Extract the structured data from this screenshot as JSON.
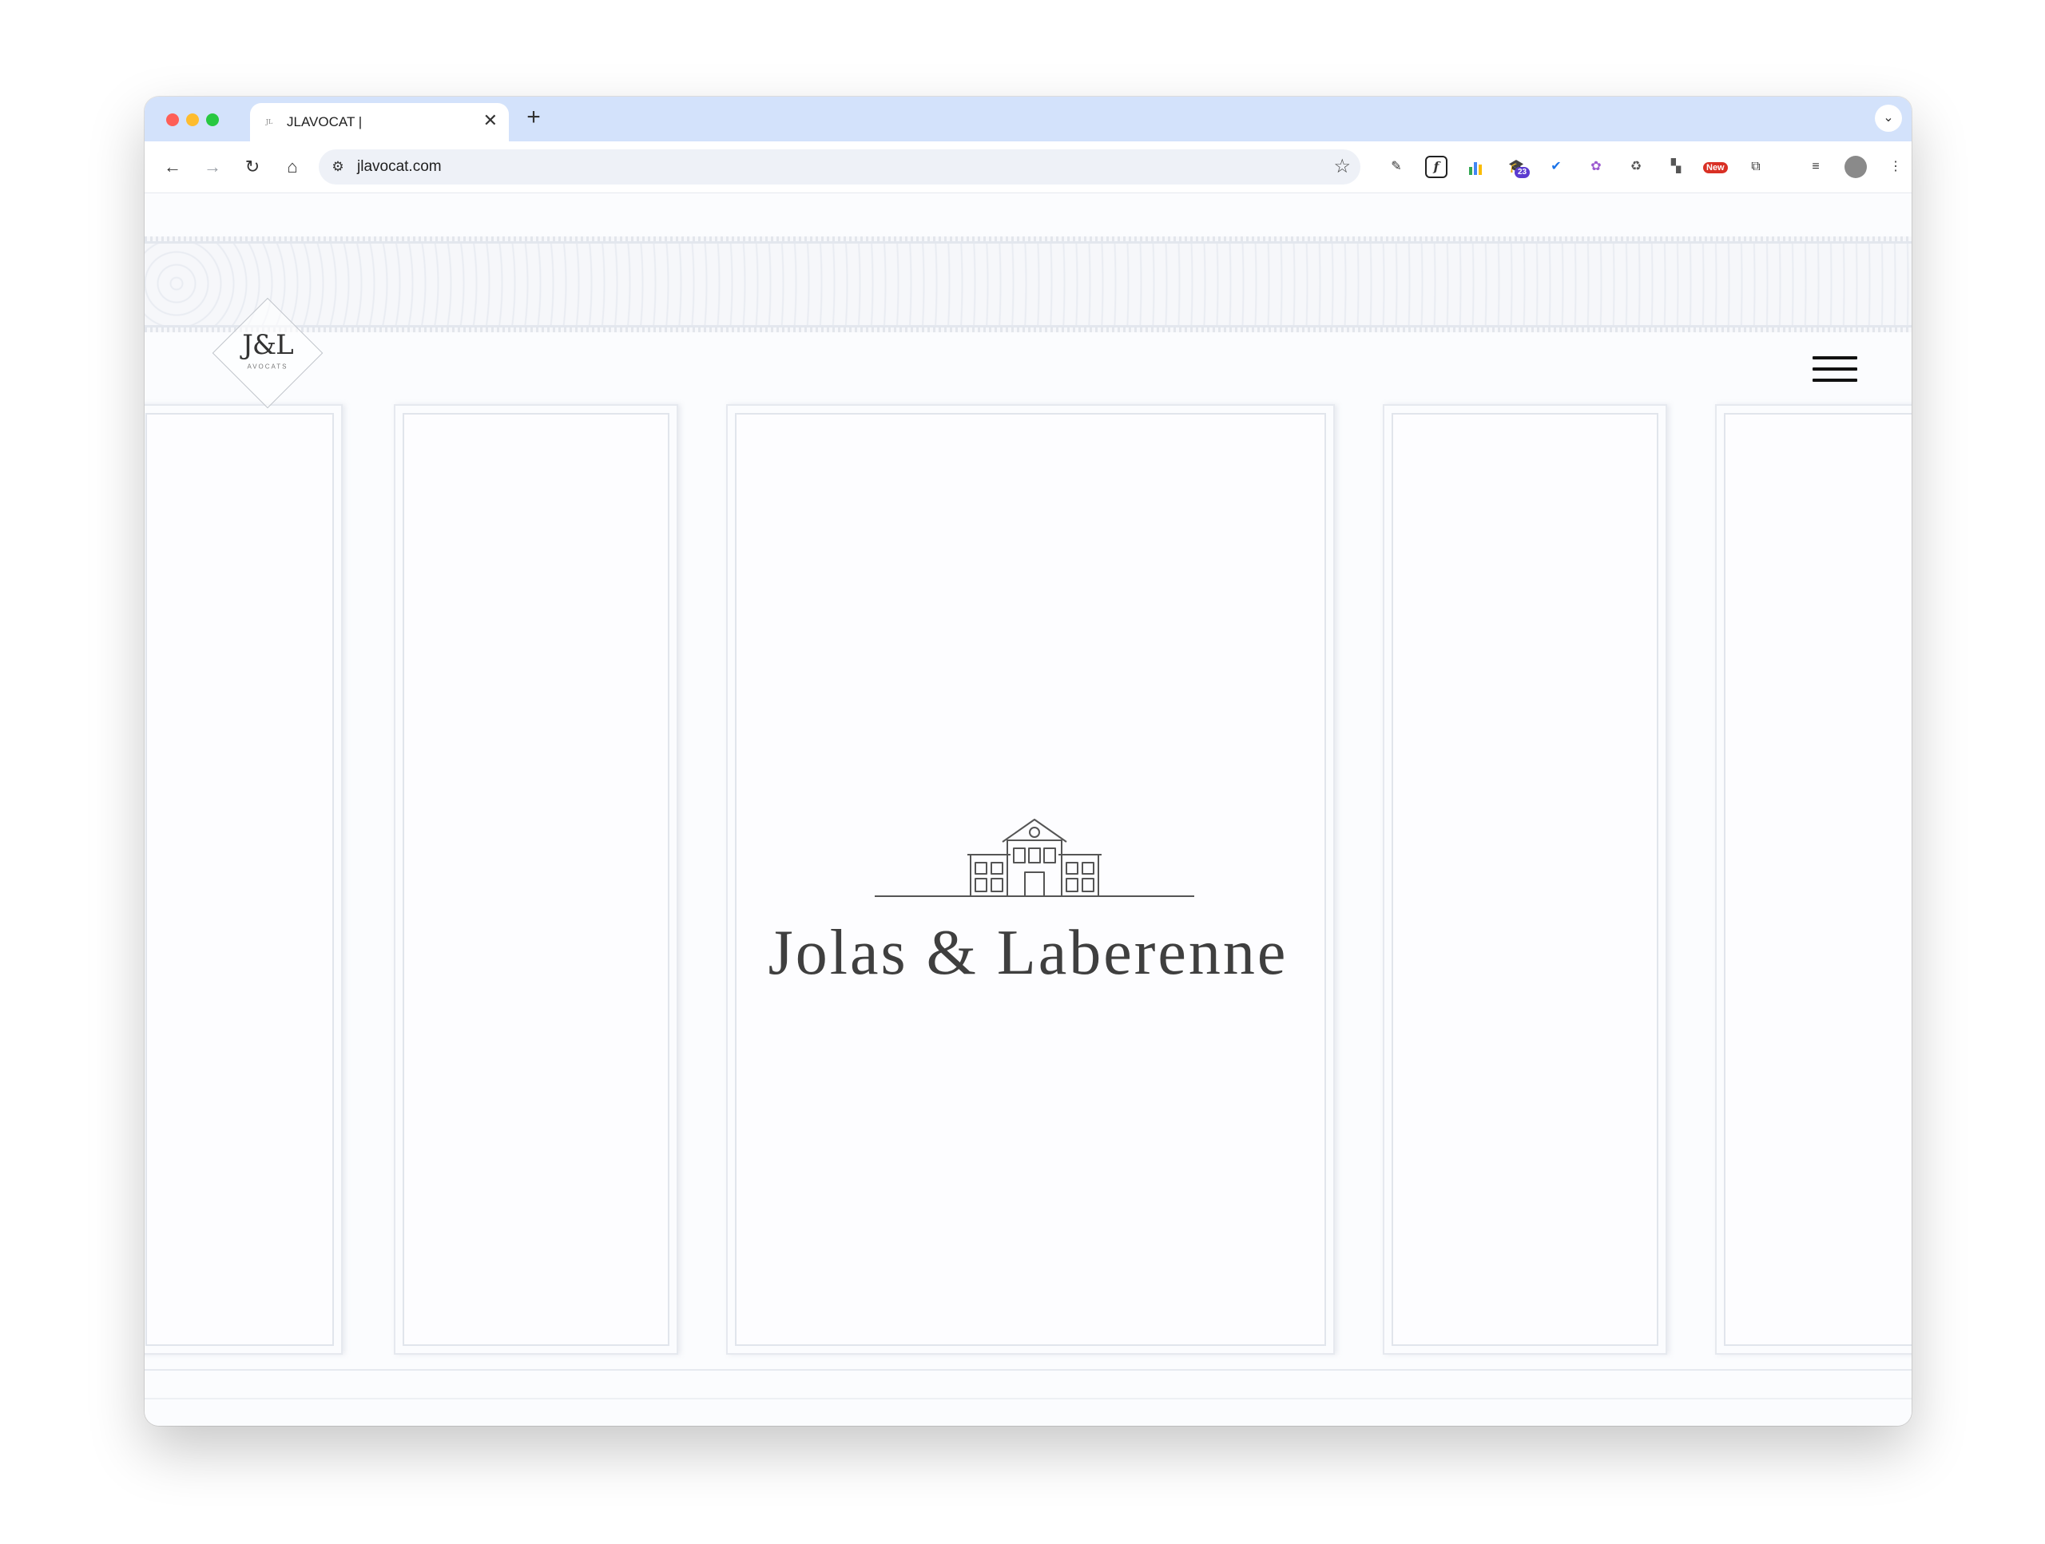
{
  "browser": {
    "tab_title": "JLAVOCAT |",
    "tab_favicon_text": "JL",
    "new_tab_label": "+",
    "close_label": "✕",
    "url": "jlavocat.com",
    "extension_badge_count": "23",
    "extension_badge_new": "New"
  },
  "site": {
    "logo_monogram": "J&L",
    "logo_subtitle": "AVOCATS",
    "brand_name": "Jolas & Laberenne"
  },
  "colors": {
    "tab_strip": "#d3e2fb",
    "page_background": "#fbfcfe",
    "brand_text": "#3f3f3f"
  }
}
